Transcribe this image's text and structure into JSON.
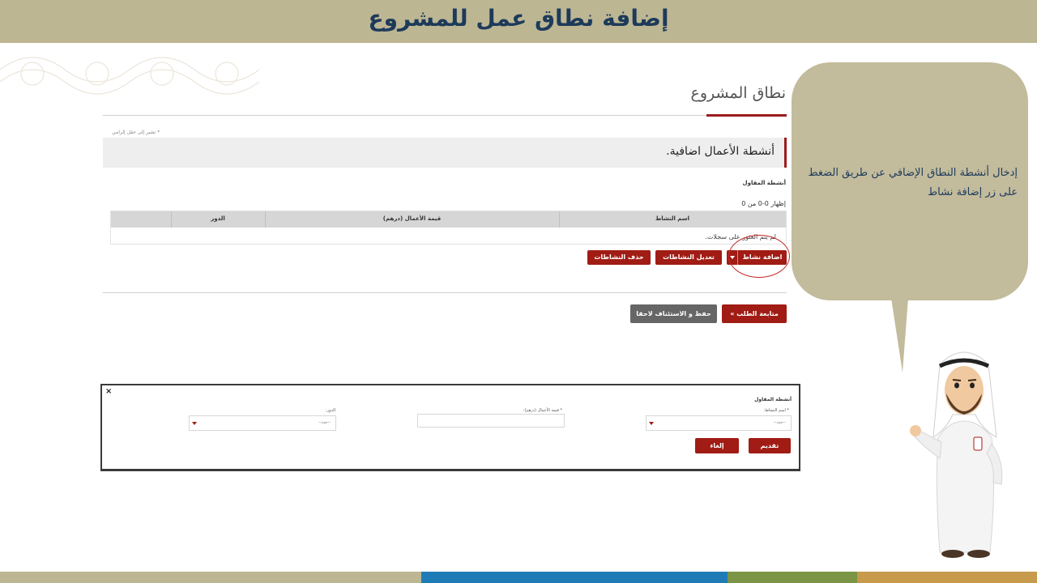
{
  "slide": {
    "title": "إضافة نطاق عمل للمشروع"
  },
  "page": {
    "heading": "نطاق المشروع",
    "required_note": "* تشير إلى حقل إلزامي",
    "section_title": "أنشطة الأعمال اضافية.",
    "contractor_label": "أنشطة المقاول",
    "showing_text": "إظهار 0-0 من 0",
    "table": {
      "columns": [
        "اسم النشاط",
        "قيمة الأعمال (درهم)",
        "الدور"
      ],
      "empty_text": "لم يتم العثور على سجلات."
    },
    "buttons": {
      "add_activity": "اضافة نشاط",
      "edit_activities": "تعديل النشاطات",
      "delete_activities": "حذف النشاطات",
      "continue": "متابعة الطلب »",
      "save_resume": "حفظ و الاستئناف لاحقا"
    }
  },
  "bubble": {
    "text": "إدخال أنشطة النطاق الإضافي عن طريق الضغط على زر إضافة نشاط"
  },
  "modal": {
    "close": "×",
    "title": "أنشطة المقاول",
    "fields": {
      "activity_name_label": "* اسم النشاط:",
      "activity_name_placeholder": "--حدد--",
      "value_label": "* قيمة الأعمال (درهم):",
      "role_label": "الدور:",
      "role_placeholder": "--حدد--"
    },
    "buttons": {
      "submit": "تقديم",
      "cancel": "إلغاء"
    }
  },
  "colors": {
    "header_band": "#bdb693",
    "title_text": "#1d3a5a",
    "accent_red": "#a01c14",
    "bubble": "#c2bb9c",
    "bar_beige": "#bdb693",
    "bar_blue": "#1f7bb5",
    "bar_olive": "#7b9445",
    "bar_gold": "#c89a4c"
  },
  "icons": {
    "close": "close-icon",
    "dropdown": "chevron-down-icon"
  }
}
